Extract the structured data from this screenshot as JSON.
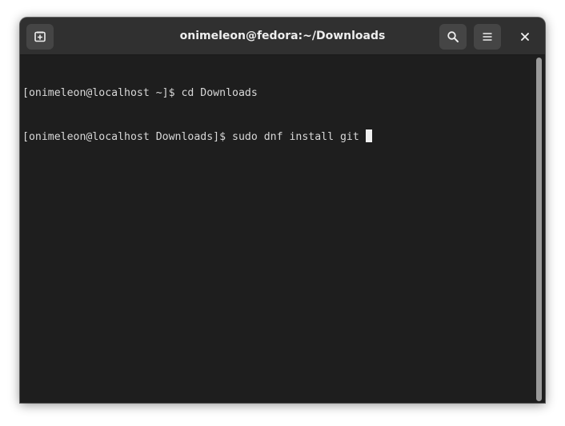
{
  "window": {
    "title": "onimeleon@fedora:~/Downloads"
  },
  "headerbar": {
    "new_tab_icon": "new-tab-icon",
    "search_icon": "search-icon",
    "menu_icon": "hamburger-menu-icon",
    "close_icon": "close-icon"
  },
  "terminal": {
    "lines": [
      "[onimeleon@localhost ~]$ cd Downloads",
      "[onimeleon@localhost Downloads]$ sudo dnf install git "
    ]
  },
  "colors": {
    "background": "#1e1e1e",
    "headerbar": "#303030",
    "text": "#d8d8d8",
    "cursor": "#f0f0f0"
  }
}
